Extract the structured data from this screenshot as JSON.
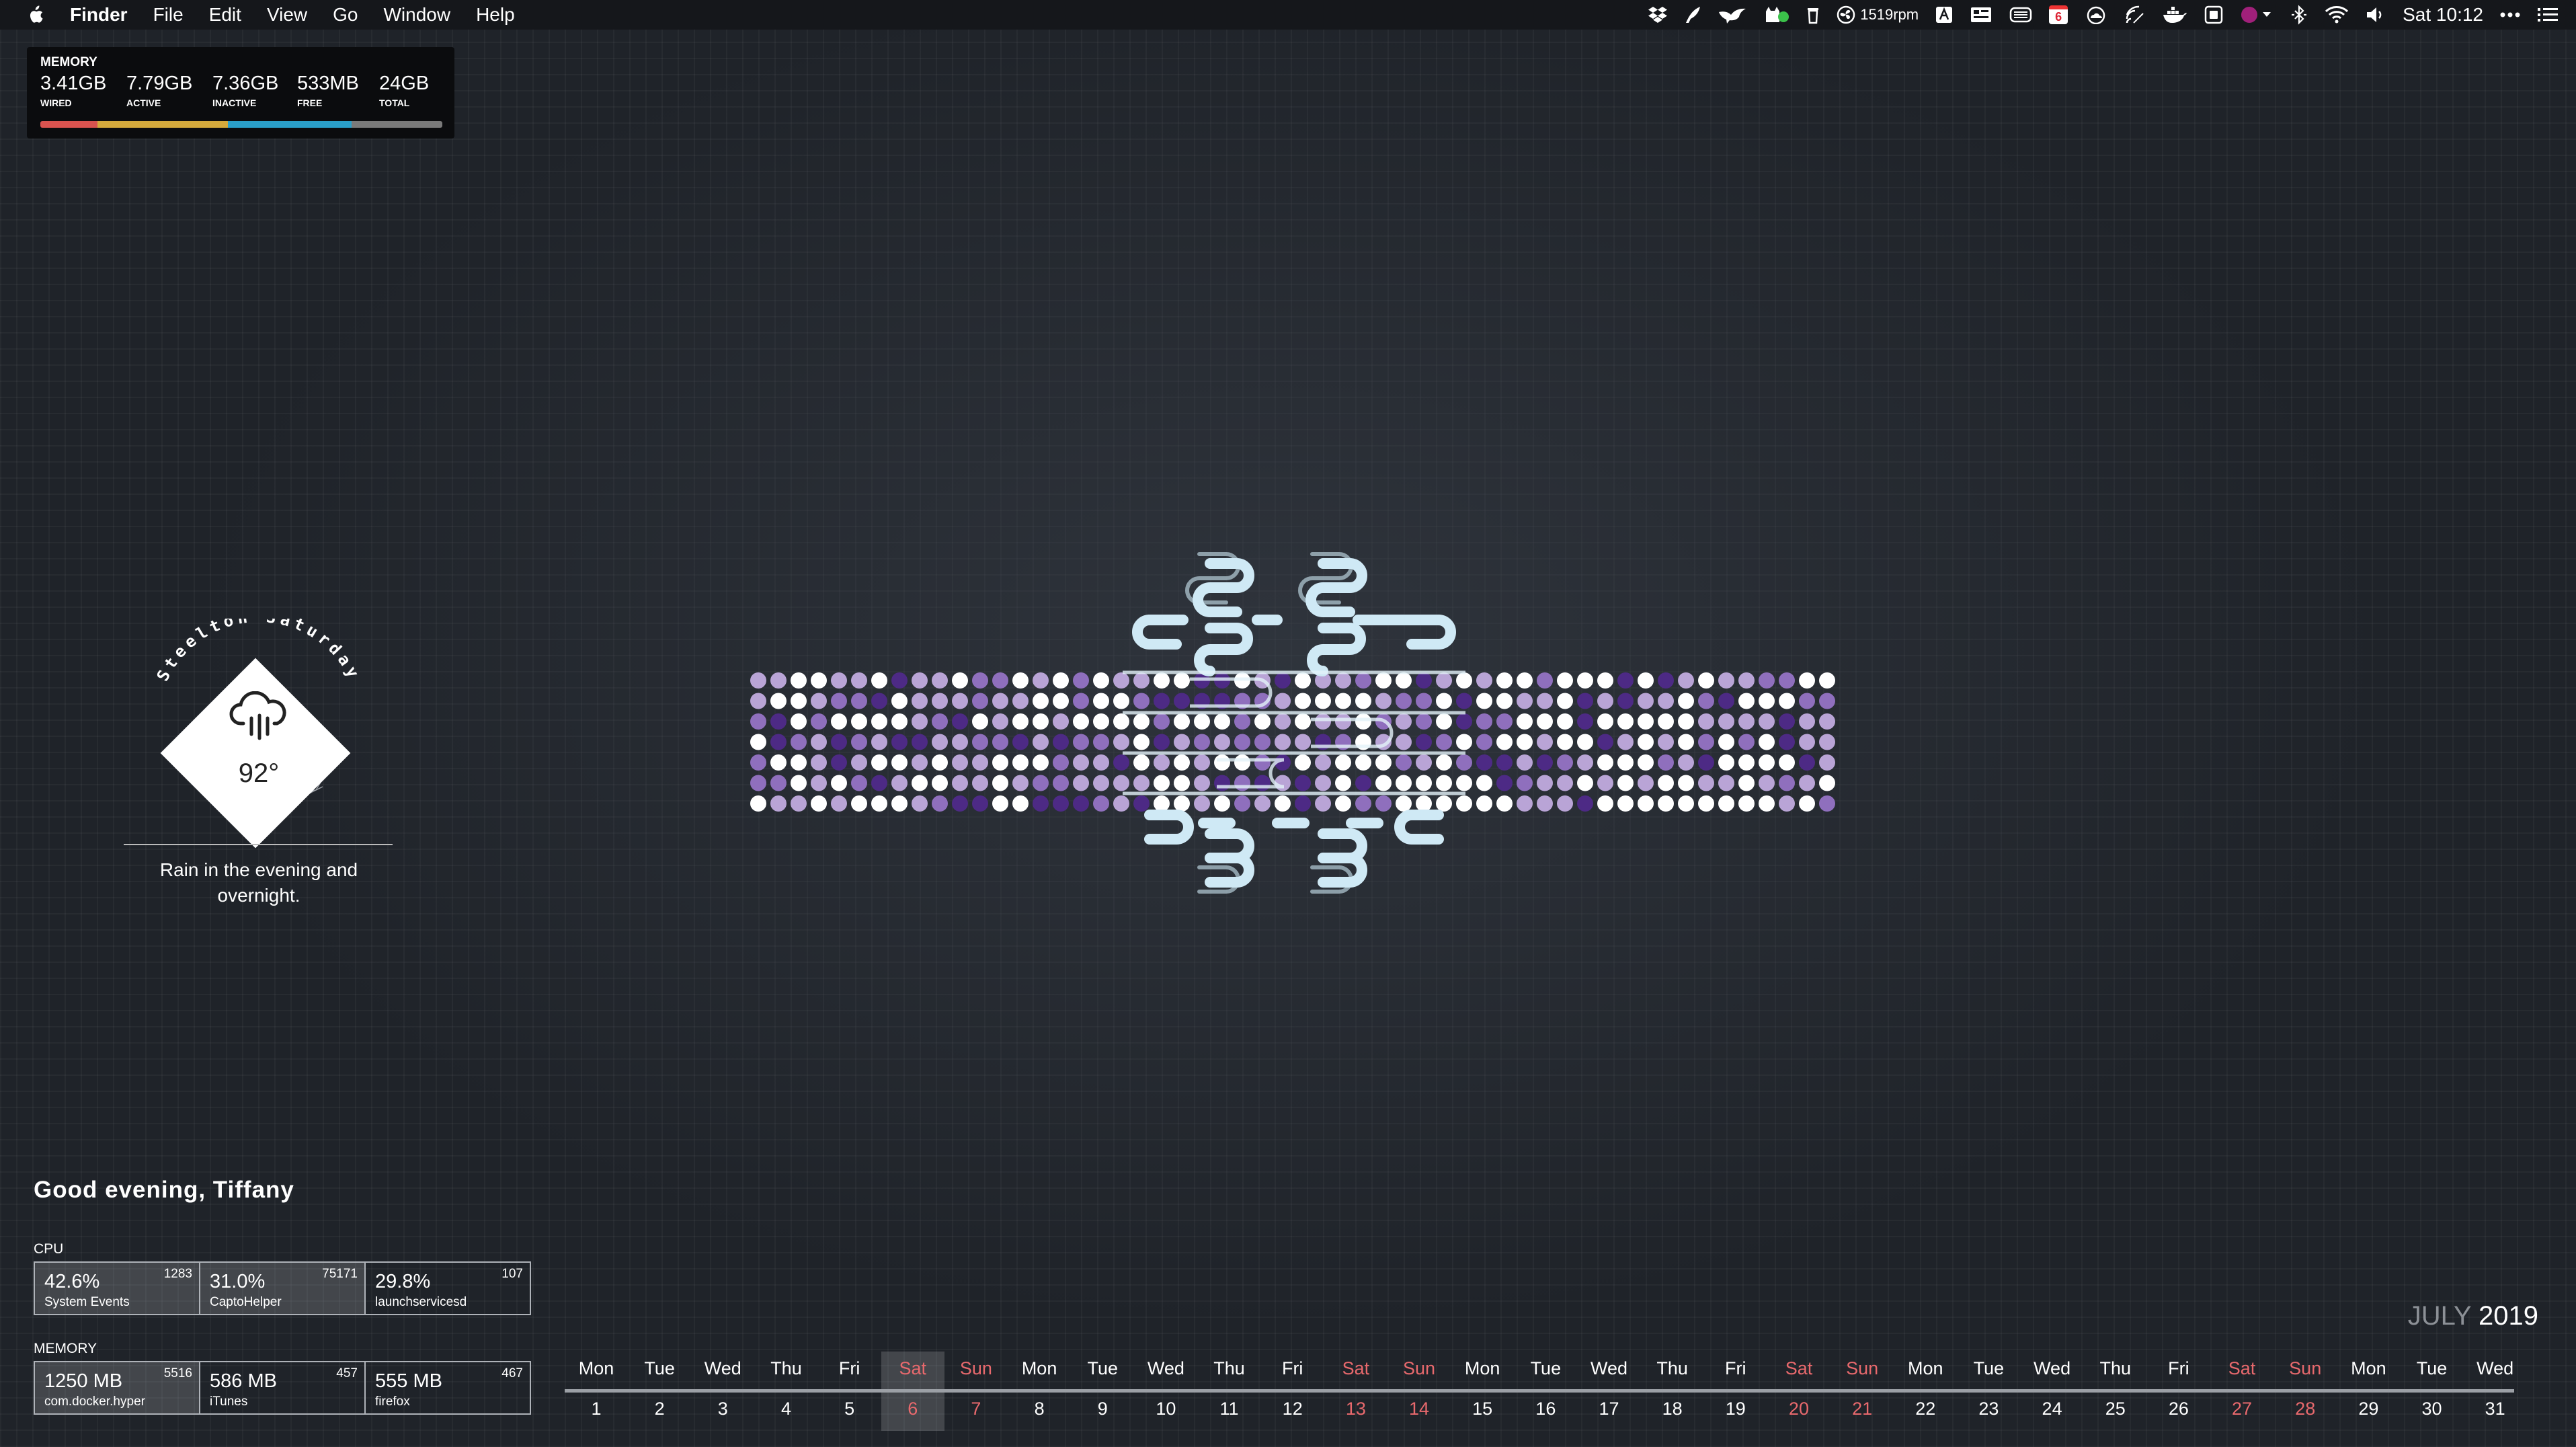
{
  "menubar": {
    "app_name": "Finder",
    "menus": [
      "File",
      "Edit",
      "View",
      "Go",
      "Window",
      "Help"
    ],
    "fan_speed": "1519rpm",
    "calendar_badge": "6",
    "clock": "Sat 10:12",
    "status_icons": [
      "dropbox-icon",
      "feather-icon",
      "bird-icon",
      "cat-icon",
      "trash-icon",
      "fan-icon",
      "text-icon",
      "keyboard-icon",
      "disk-icon",
      "calendar-icon",
      "cloud-icon",
      "wifi-signal-icon",
      "docker-icon",
      "window-icon",
      "record-icon",
      "bluetooth-icon",
      "wifi-icon",
      "volume-icon",
      "more-icon",
      "list-icon"
    ]
  },
  "memory": {
    "title": "MEMORY",
    "stats": [
      {
        "value": "3.41GB",
        "label": "WIRED",
        "color": "#d9534f"
      },
      {
        "value": "7.79GB",
        "label": "ACTIVE",
        "color": "#d4a93c"
      },
      {
        "value": "7.36GB",
        "label": "INACTIVE",
        "color": "#2a9fc9"
      },
      {
        "value": "533MB",
        "label": "FREE",
        "color": "#7a7a7a"
      },
      {
        "value": "24GB",
        "label": "TOTAL",
        "color": "#7a7a7a"
      }
    ],
    "bar_fractions": [
      0.142,
      0.325,
      0.307,
      0.226
    ]
  },
  "weather": {
    "arc_text": "Steelton Saturday",
    "temperature": "92°",
    "description": "Rain in the evening and overnight.",
    "icon": "rain-cloud-icon"
  },
  "greeting": "Good evening, Tiffany",
  "cpu": {
    "label": "CPU",
    "processes": [
      {
        "value": "42.6%",
        "name": "System Events",
        "pid": "1283"
      },
      {
        "value": "31.0%",
        "name": "CaptoHelper",
        "pid": "75171"
      },
      {
        "value": "29.8%",
        "name": "launchservicesd",
        "pid": "107"
      }
    ]
  },
  "memory_procs": {
    "label": "MEMORY",
    "processes": [
      {
        "value": "1250 MB",
        "name": "com.docker.hyper",
        "pid": "5516"
      },
      {
        "value": "586 MB",
        "name": "iTunes",
        "pid": "457"
      },
      {
        "value": "555 MB",
        "name": "firefox",
        "pid": "467"
      }
    ]
  },
  "calendar": {
    "month": "JULY",
    "year": "2019",
    "today": 6,
    "days": [
      {
        "dn": "Mon",
        "dd": "1"
      },
      {
        "dn": "Tue",
        "dd": "2"
      },
      {
        "dn": "Wed",
        "dd": "3"
      },
      {
        "dn": "Thu",
        "dd": "4"
      },
      {
        "dn": "Fri",
        "dd": "5"
      },
      {
        "dn": "Sat",
        "dd": "6"
      },
      {
        "dn": "Sun",
        "dd": "7"
      },
      {
        "dn": "Mon",
        "dd": "8"
      },
      {
        "dn": "Tue",
        "dd": "9"
      },
      {
        "dn": "Wed",
        "dd": "10"
      },
      {
        "dn": "Thu",
        "dd": "11"
      },
      {
        "dn": "Fri",
        "dd": "12"
      },
      {
        "dn": "Sat",
        "dd": "13"
      },
      {
        "dn": "Sun",
        "dd": "14"
      },
      {
        "dn": "Mon",
        "dd": "15"
      },
      {
        "dn": "Tue",
        "dd": "16"
      },
      {
        "dn": "Wed",
        "dd": "17"
      },
      {
        "dn": "Thu",
        "dd": "18"
      },
      {
        "dn": "Fri",
        "dd": "19"
      },
      {
        "dn": "Sat",
        "dd": "20"
      },
      {
        "dn": "Sun",
        "dd": "21"
      },
      {
        "dn": "Mon",
        "dd": "22"
      },
      {
        "dn": "Tue",
        "dd": "23"
      },
      {
        "dn": "Wed",
        "dd": "24"
      },
      {
        "dn": "Thu",
        "dd": "25"
      },
      {
        "dn": "Fri",
        "dd": "26"
      },
      {
        "dn": "Sat",
        "dd": "27"
      },
      {
        "dn": "Sun",
        "dd": "28"
      },
      {
        "dn": "Mon",
        "dd": "29"
      },
      {
        "dn": "Tue",
        "dd": "30"
      },
      {
        "dn": "Wed",
        "dd": "31"
      }
    ]
  },
  "colors": {
    "weekend": "#e8696d",
    "dots": [
      "#ffffff",
      "#b9a4d6",
      "#8f6fbd",
      "#4d2a85"
    ],
    "logo_stroke": "#cfe9f5"
  }
}
